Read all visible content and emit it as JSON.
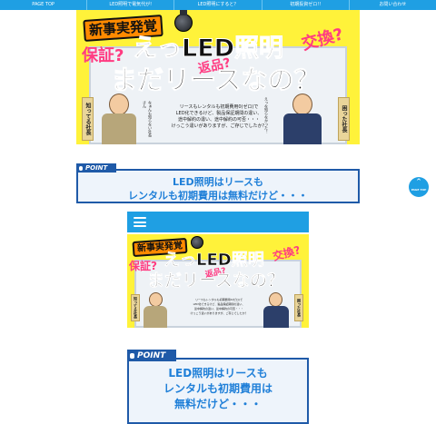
{
  "nav": {
    "items": [
      {
        "label": "PAGE TOP"
      },
      {
        "label": "LED照明で電気代が!"
      },
      {
        "label": "LED照明にすると？"
      },
      {
        "label": "初期投資ゼロ!!"
      },
      {
        "label": "お問い合わせ"
      }
    ]
  },
  "hero": {
    "sticker": "新事実発覚",
    "title_line1": "えっLED照明",
    "title_line2": "まだリースなの？",
    "q_left": "保証?",
    "q_mid": "返品?",
    "q_right": "交換?",
    "body": "リースもレンタルも初期費用0(ゼロ)で\nLED化できるけど、製品保証期間の違い、\n途中解約の違い、途中解約の可否・・・\nけっこう違いがありますが、ご存じでしたか？",
    "plaque_left": "知ってる社長",
    "plaque_right": "困った社長",
    "speech_left": "なぁんも知らない社長さん",
    "speech_right": "えっな知らなかった！"
  },
  "point": {
    "tab_label": "POINT",
    "text_desktop": "LED照明はリースも\nレンタルも初期費用は無料だけど・・・",
    "text_mobile": "LED照明はリースも\nレンタルも初期費用は\n無料だけど・・・"
  },
  "pagetop": {
    "arrow": "⌃",
    "label": "PAGE TOP"
  },
  "colors": {
    "nav_blue": "#1f9fe3",
    "hero_yellow": "#fff23a",
    "point_blue": "#1f5aa8",
    "point_text": "#1f7fd8",
    "accent_pink": "#ff3c82",
    "sticker_orange": "#ff8a00"
  },
  "icons": [
    "hamburger-icon",
    "page-top-arrow-icon",
    "led-lamp-icon"
  ]
}
